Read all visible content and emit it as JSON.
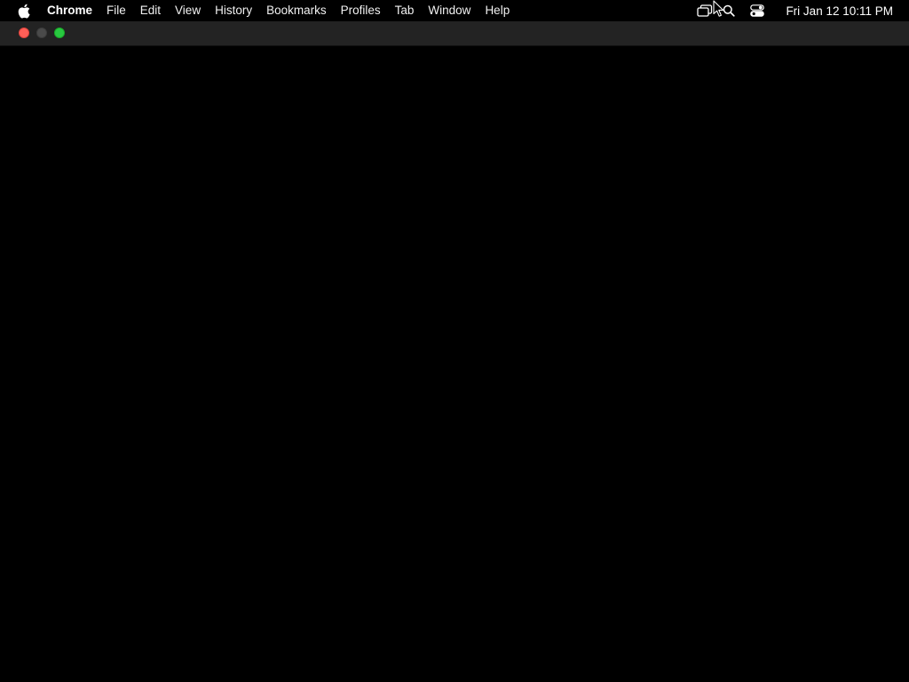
{
  "menubar": {
    "apple_icon": "apple-logo-icon",
    "app_name": "Chrome",
    "items": [
      {
        "label": "File"
      },
      {
        "label": "Edit"
      },
      {
        "label": "View"
      },
      {
        "label": "History"
      },
      {
        "label": "Bookmarks"
      },
      {
        "label": "Profiles"
      },
      {
        "label": "Tab"
      },
      {
        "label": "Window"
      },
      {
        "label": "Help"
      }
    ],
    "status_icons": [
      "screen-mirroring-icon",
      "spotlight-search-icon",
      "control-center-icon"
    ],
    "clock": "Fri Jan 12  10:11 PM"
  },
  "window": {
    "traffic_lights": {
      "close_color": "#ff5f57",
      "minimize_color": "#4a4a4a",
      "maximize_color": "#28c840"
    },
    "content_background": "#000000"
  }
}
